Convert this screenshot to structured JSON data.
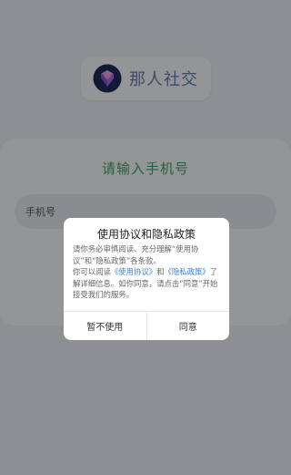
{
  "app": {
    "name": "那人社交",
    "logo_icon": "diamond-heart-icon"
  },
  "login": {
    "title": "请输入手机号",
    "phone_placeholder": "手机号"
  },
  "dialog": {
    "title": "使用协议和隐私政策",
    "line1": "请你务必审慎阅读、充分理解“使用协议”和“隐私政策”各条款。",
    "line2_prefix": "你可以阅读",
    "user_agreement_link": "《使用协议》",
    "and": "和",
    "privacy_link": "《隐私政策》",
    "line2_suffix": "了解详细信息。如你同意，请点击“同意”开始接受我们的服务。",
    "decline_label": "暂不使用",
    "accept_label": "同意"
  },
  "colors": {
    "accent_green": "#3aa36b",
    "brand_text": "#6a7bb3",
    "link_blue": "#3b82d6"
  }
}
